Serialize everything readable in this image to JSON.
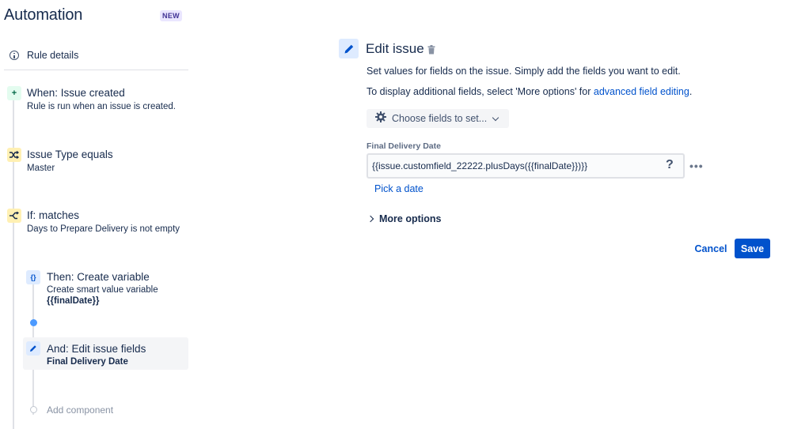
{
  "app": {
    "title": "Automation",
    "badge": "NEW"
  },
  "rule_details": {
    "label": "Rule details",
    "icon": "info-icon"
  },
  "flow": {
    "trigger": {
      "title": "When: Issue created",
      "subtitle": "Rule is run when an issue is created.",
      "icon": "plus-icon",
      "icon_glyph": "+"
    },
    "condition_1": {
      "title": "Issue Type equals",
      "subtitle": "Master",
      "icon": "shuffle-icon"
    },
    "condition_2": {
      "title": "If: matches",
      "subtitle": "Days to Prepare Delivery is not empty",
      "icon": "branch-icon"
    },
    "action_1": {
      "title": "Then: Create variable",
      "subtitle": "Create smart value variable",
      "bold": "{{finalDate}}",
      "icon": "braces-icon",
      "icon_glyph": "{}"
    },
    "action_2": {
      "title": "And: Edit issue fields",
      "bold": "Final Delivery Date",
      "icon": "pencil-icon",
      "selected": true
    },
    "add_component": "Add component"
  },
  "editor": {
    "title": "Edit issue",
    "icon": "pencil-icon",
    "delete_icon": "trash-icon",
    "description_1": "Set values for fields on the issue. Simply add the fields you want to edit.",
    "description_2_prefix": "To display additional fields, select 'More options' for ",
    "description_2_link": "advanced field editing",
    "description_2_suffix": ".",
    "choose_fields_label": "Choose fields to set...",
    "field": {
      "label": "Final Delivery Date",
      "value": "{{issue.customfield_22222.plusDays({{finalDate}})}}",
      "help": "?",
      "more": "•••"
    },
    "pick_date": "Pick a date",
    "more_options": "More options",
    "cancel": "Cancel",
    "save": "Save"
  },
  "colors": {
    "primary": "#0052cc",
    "text": "#172b4d",
    "badge_bg": "#eae6ff",
    "badge_text": "#403294",
    "connector_dot": "#4c9aff"
  }
}
